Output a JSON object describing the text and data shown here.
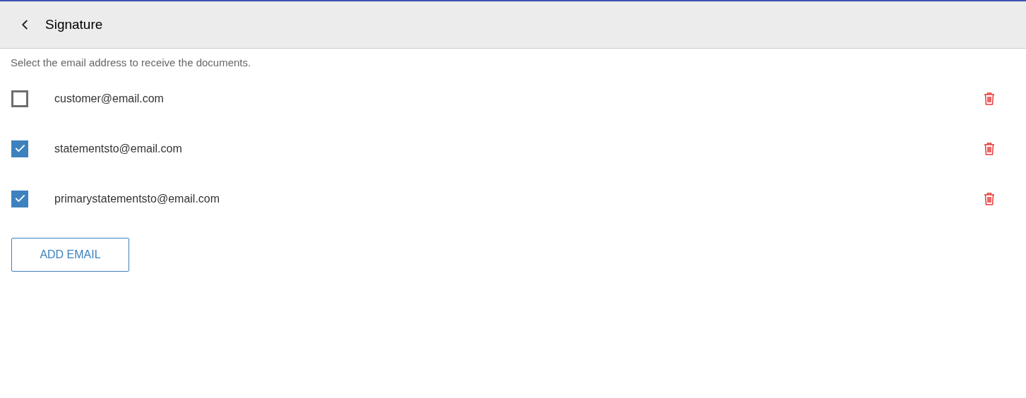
{
  "header": {
    "title": "Signature"
  },
  "instruction": "Select the email address to receive the documents.",
  "emails": [
    {
      "address": "customer@email.com",
      "checked": false
    },
    {
      "address": "statementsto@email.com",
      "checked": true
    },
    {
      "address": "primarystatementsto@email.com",
      "checked": true
    }
  ],
  "add_button": "ADD EMAIL"
}
